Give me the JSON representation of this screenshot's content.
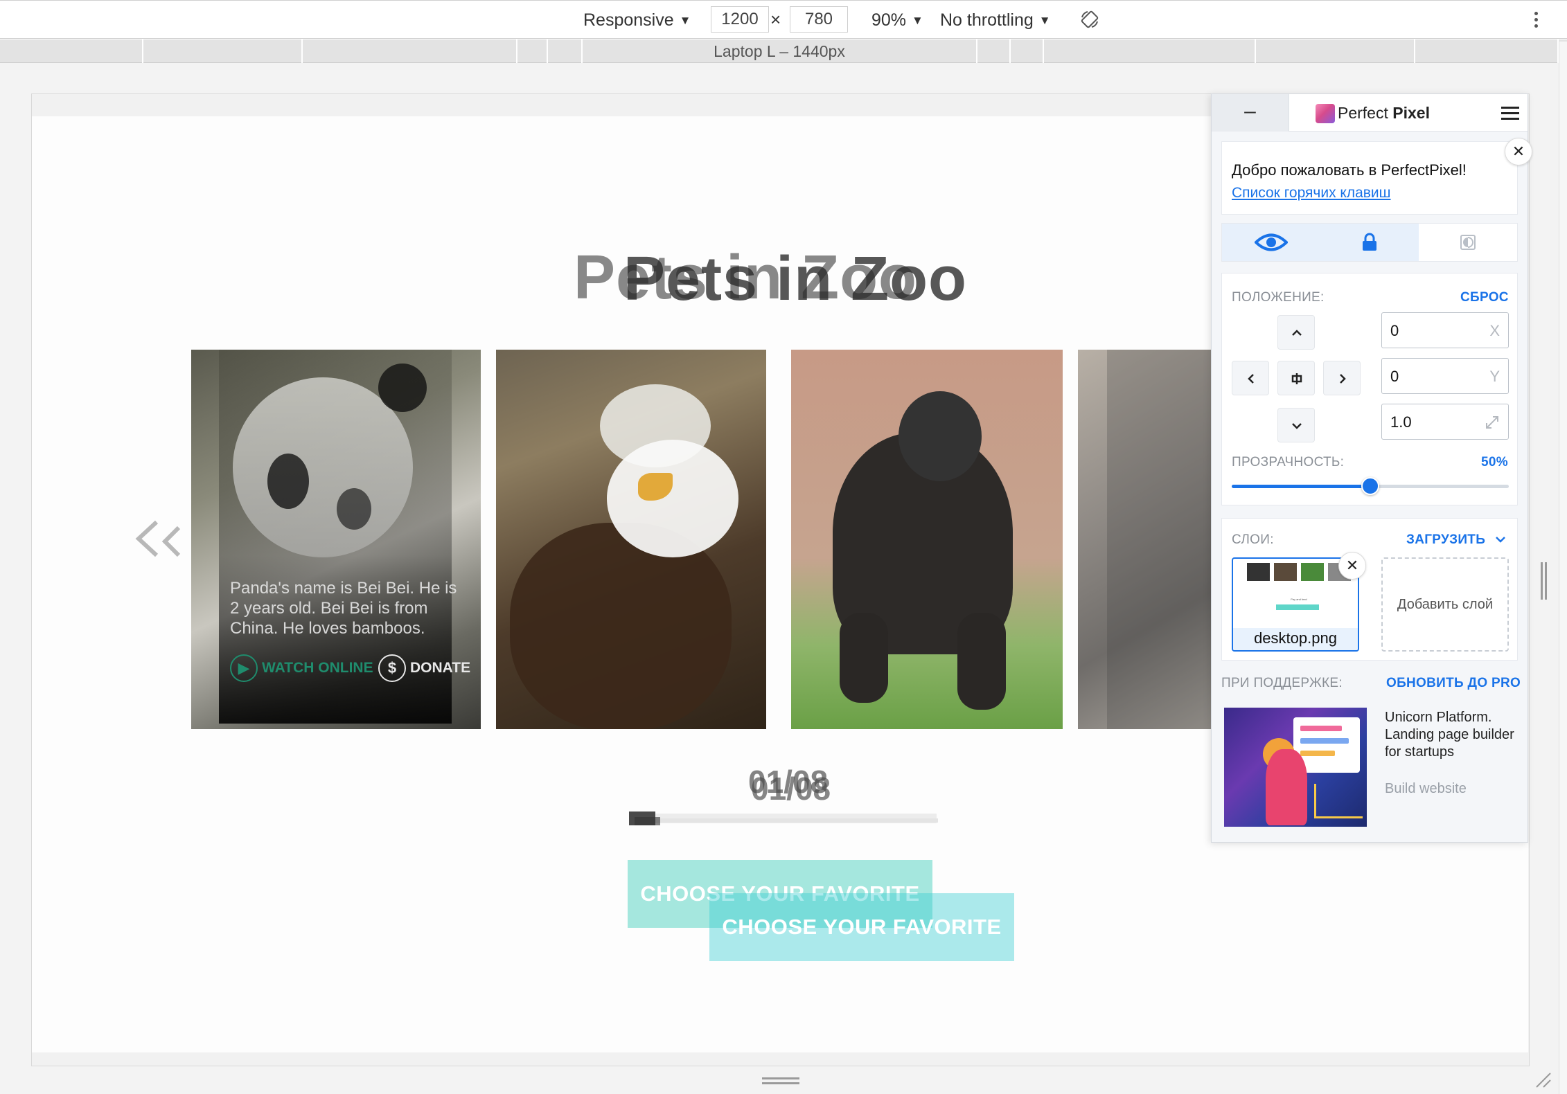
{
  "devtools": {
    "device": "Responsive",
    "width": "1200",
    "height": "780",
    "dimension_separator": "×",
    "zoom": "90%",
    "throttling": "No throttling",
    "media_query_label": "Laptop L – 1440px"
  },
  "site": {
    "title_layer_a": "Pets in Zoo",
    "title_layer_b": "Pets in Zoo",
    "panda_text": "Panda's name is Bei Bei. He is 2 years old. Bei Bei is from China. He loves bamboos.",
    "watch_label": "WATCH ONLINE",
    "donate_label": "DONATE",
    "watch_icon": "play-icon",
    "donate_icon": "dollar-icon",
    "counter_a": "01/08",
    "counter_b": "01/08",
    "progress": 0.085,
    "cta_a": "CHOOSE YOUR FAVORITE",
    "cta_b": "CHOOSE YOUR FAVORITE",
    "accent_color": "#3acdb8"
  },
  "perfect_pixel": {
    "minimize_label": "–",
    "brand_light": "Perfect ",
    "brand_bold": "Pixel",
    "welcome_text": "Добро пожаловать в PerfectPixel!",
    "hotkeys_link": "Список горячих клавиш",
    "position_label": "ПОЛОЖЕНИЕ:",
    "reset_label": "СБРОС",
    "x_value": "0",
    "x_unit": "X",
    "y_value": "0",
    "y_unit": "Y",
    "scale_value": "1.0",
    "opacity_label": "ПРОЗРАЧНОСТЬ:",
    "opacity_value": "50%",
    "opacity": 0.5,
    "layers_label": "СЛОИ:",
    "upload_label": "ЗАГРУЗИТЬ",
    "layer_name": "desktop.png",
    "layer_thumb_heading": "Pay and feed",
    "add_layer_label": "Добавить слой",
    "support_label": "ПРИ ПОДДЕРЖКЕ:",
    "upgrade_label": "ОБНОВИТЬ ДО PRO",
    "ad_title": "Unicorn Platform. Landing page builder for startups",
    "ad_link": "Build website",
    "accent_color": "#1a73e8"
  }
}
